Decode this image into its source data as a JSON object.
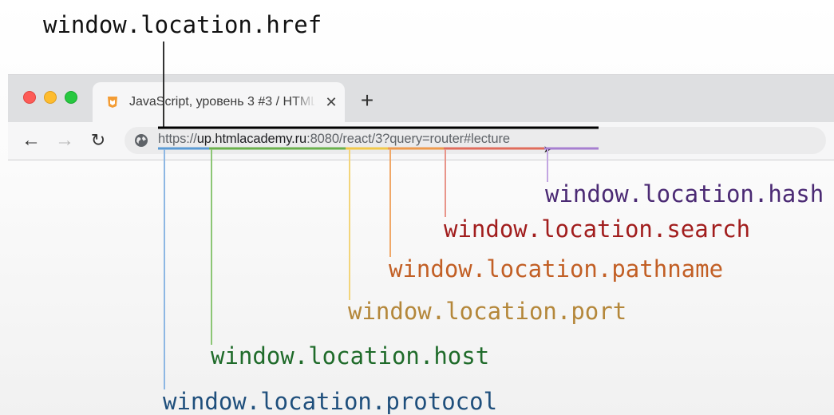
{
  "browser": {
    "tab_title": "JavaScript, уровень 3 #3 / HTML",
    "tab_close_glyph": "✕",
    "new_tab_glyph": "+",
    "nav": {
      "back_glyph": "←",
      "forward_glyph": "→",
      "reload_glyph": "↻"
    },
    "url_parts": {
      "protocol": "https://",
      "host": "up.htmlacademy.ru",
      "port": ":8080",
      "pathname": "/react/3",
      "search": "?query=router",
      "hash": "#lecture"
    },
    "icons": {
      "favicon": "htmlacademy-favicon-icon",
      "globe": "globe-icon",
      "cursor": "mouse-cursor-icon"
    }
  },
  "labels": {
    "href": "window.location.href",
    "hash": "window.location.hash",
    "search": "window.location.search",
    "pathname": "window.location.pathname",
    "port": "window.location.port",
    "host": "window.location.host",
    "protocol": "window.location.protocol"
  },
  "colors": {
    "href": "#111111",
    "protocol": "#5b9bd5",
    "host": "#6ab04c",
    "port": "#f1c84b",
    "pathname": "#ee9a4d",
    "search": "#e06c5c",
    "hash": "#a77fd0"
  }
}
